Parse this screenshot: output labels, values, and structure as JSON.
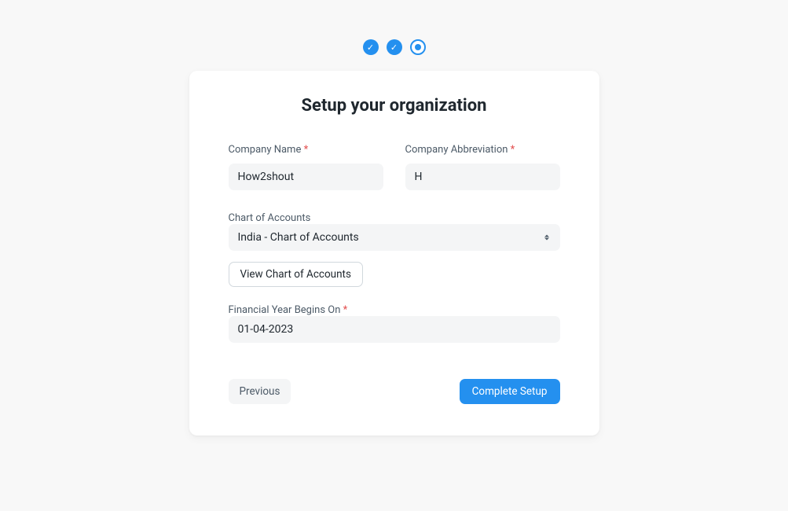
{
  "title": "Setup your organization",
  "stepper": {
    "steps": [
      {
        "status": "complete"
      },
      {
        "status": "complete"
      },
      {
        "status": "current"
      }
    ]
  },
  "fields": {
    "company_name": {
      "label": "Company Name",
      "required": "*",
      "value": "How2shout"
    },
    "company_abbr": {
      "label": "Company Abbreviation",
      "required": "*",
      "value": "H"
    },
    "chart_of_accounts": {
      "label": "Chart of Accounts",
      "value": "India - Chart of Accounts"
    },
    "view_chart_btn": "View Chart of Accounts",
    "financial_year": {
      "label": "Financial Year Begins On",
      "required": "*",
      "value": "01-04-2023"
    }
  },
  "footer": {
    "previous": "Previous",
    "complete": "Complete Setup"
  }
}
